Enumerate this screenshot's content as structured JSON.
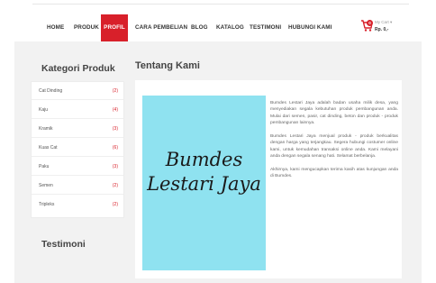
{
  "nav": {
    "items": [
      {
        "label": "HOME"
      },
      {
        "label": "PRODUK"
      },
      {
        "label": "PROFIL"
      },
      {
        "label": "CARA PEMBELIAN"
      },
      {
        "label": "BLOG"
      },
      {
        "label": "KATALOG"
      },
      {
        "label": "TESTIMONI"
      },
      {
        "label": "HUBUNGI KAMI"
      }
    ],
    "active": "PROFIL",
    "accent": "#d8202a"
  },
  "cart": {
    "icon": "shopping-cart-icon",
    "badge": "0",
    "title": "My Cart  ▾",
    "total": "Rp. 0,-"
  },
  "sidebar": {
    "title": "Kategori Produk",
    "categories": [
      {
        "name": "Cat Dinding",
        "count": "(2)"
      },
      {
        "name": "Kaju",
        "count": "(4)"
      },
      {
        "name": "Kramik",
        "count": "(3)"
      },
      {
        "name": "Kuas Cat",
        "count": "(6)"
      },
      {
        "name": "Paku",
        "count": "(3)"
      },
      {
        "name": "Semen",
        "count": "(2)"
      },
      {
        "name": "Tripleks",
        "count": "(2)"
      }
    ],
    "testimoni_title": "Testimoni"
  },
  "content": {
    "title": "Tentang Kami",
    "image_text_line1": "Bumdes",
    "image_text_line2": "Lestari Jaya",
    "image_bg": "#8fe2f0",
    "paragraphs": [
      "Bumdes Lestari Jaya adalah badan usaha milik desa, yang menyediakan segala kebutuhan produk pembangunan anda. Mulai dari semen, pasir, cat dinding, beton dan produk - produk pembangunan lainnya.",
      "Bumdes Lestari Jaya menjual produk - produk berkualitas dengan harga yang terjangkau. Segera hubungi costumer online kami, untuk kemudahan transaksi online anda. Kami melayani anda dengan segala senang hati. Selamat berbelanja.",
      "Akhirnya, kami mengucapkan terima kasih atas kunjungan anda di Bumdes."
    ]
  }
}
